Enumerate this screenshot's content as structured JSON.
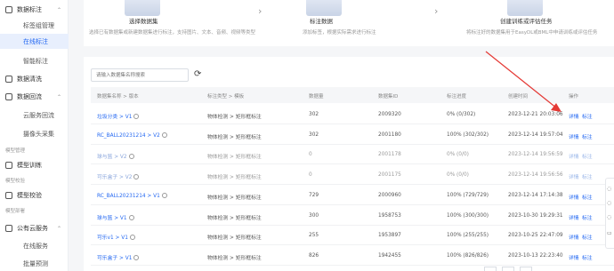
{
  "sidebar": {
    "groups": [
      {
        "label": "数据标注",
        "icon": "tag-icon",
        "subs": [
          "标签组管理",
          "在线标注",
          "智能标注"
        ],
        "active_index": 1
      },
      {
        "label": "数据清洗",
        "icon": "clean-icon",
        "subs": []
      },
      {
        "label": "数据回流",
        "icon": "flow-icon",
        "subs": [
          "云服务回流",
          "摄像头采集"
        ]
      },
      {
        "label": "模型训练",
        "icon": "train-icon",
        "subs": []
      },
      {
        "label": "模型校验",
        "icon": "check-icon",
        "subs": []
      },
      {
        "label": "公有云服务",
        "icon": "cloud-icon",
        "subs": [
          "在线服务",
          "批量预测"
        ]
      }
    ],
    "sections": [
      "模型管理",
      "模型校验",
      "模型部署"
    ]
  },
  "flow": {
    "steps": [
      {
        "title": "选择数据集",
        "desc": "选择已有数据集或新建数据集进行标注，支持图片、文本、音频、视频等类型"
      },
      {
        "title": "标注数据",
        "desc": "添加标签，根据实际需求进行标注"
      },
      {
        "title": "创建训练或评估任务",
        "desc": "将标注好的数据集用于EasyDL或BML中申请训练或评估任务"
      }
    ]
  },
  "search": {
    "placeholder": "请输入数据集名称搜索"
  },
  "table": {
    "headers": [
      "数据集名称 > 版本",
      "标注类型 > 模板",
      "数据量",
      "数据集ID",
      "标注进度",
      "创建时间",
      "操作"
    ],
    "rows": [
      {
        "name": "垃圾分类 > V1",
        "type": "物体检测 > 矩形框标注",
        "count": "302",
        "id": "2009320",
        "progress": "0% (0/302)",
        "created": "2023-12-21 20:03:06",
        "disabled": false
      },
      {
        "name": "RC_BALL20231214 > V2",
        "type": "物体检测 > 矩形框标注",
        "count": "302",
        "id": "2001180",
        "progress": "100% (302/302)",
        "created": "2023-12-14 19:57:04",
        "disabled": false
      },
      {
        "name": "球与篮 > V2",
        "type": "物体检测 > 矩形框标注",
        "count": "0",
        "id": "2001178",
        "progress": "0% (0/0)",
        "created": "2023-12-14 19:56:59",
        "disabled": true
      },
      {
        "name": "可乐盒子 > V2",
        "type": "物体检测 > 矩形框标注",
        "count": "0",
        "id": "2001175",
        "progress": "0% (0/0)",
        "created": "2023-12-14 19:56:56",
        "disabled": true
      },
      {
        "name": "RC_BALL20231214 > V1",
        "type": "物体检测 > 矩形框标注",
        "count": "729",
        "id": "2000960",
        "progress": "100% (729/729)",
        "created": "2023-12-14 17:14:38",
        "disabled": false
      },
      {
        "name": "球与篮 > V1",
        "type": "物体检测 > 矩形框标注",
        "count": "300",
        "id": "1958753",
        "progress": "100% (300/300)",
        "created": "2023-10-30 19:29:31",
        "disabled": false
      },
      {
        "name": "可乐v1 > V1",
        "type": "物体检测 > 矩形框标注",
        "count": "255",
        "id": "1953897",
        "progress": "100% (255/255)",
        "created": "2023-10-25 22:47:09",
        "disabled": false
      },
      {
        "name": "可乐盒子 > V1",
        "type": "物体检测 > 矩形框标注",
        "count": "826",
        "id": "1942455",
        "progress": "100% (826/826)",
        "created": "2023-10-13 22:23:40",
        "disabled": false
      }
    ],
    "action_detail": "详情",
    "action_label": "标注"
  },
  "colors": {
    "accent": "#2468f2",
    "annotation": "#e53935"
  }
}
